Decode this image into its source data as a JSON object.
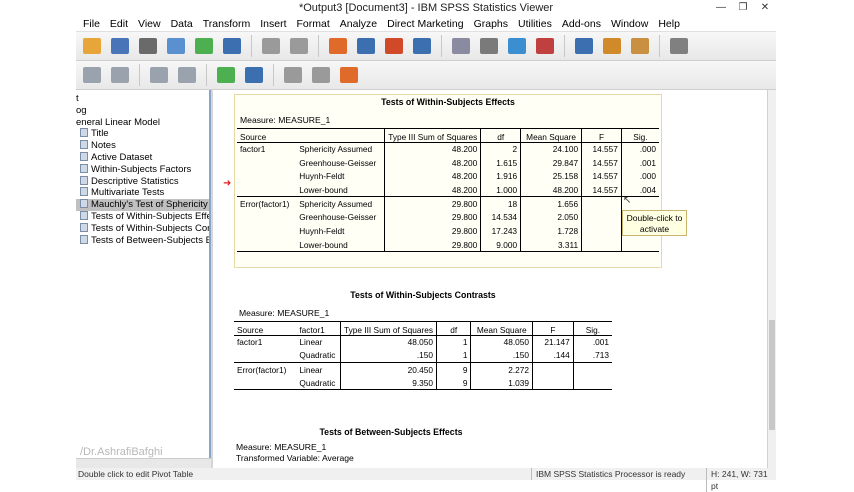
{
  "window": {
    "title": "*Output3 [Document3] - IBM SPSS Statistics Viewer"
  },
  "menu": [
    "File",
    "Edit",
    "View",
    "Data",
    "Transform",
    "Insert",
    "Format",
    "Analyze",
    "Direct Marketing",
    "Graphs",
    "Utilities",
    "Add-ons",
    "Window",
    "Help"
  ],
  "toolbar1_icons": [
    "open-icon",
    "save-icon",
    "print-icon",
    "print-preview-icon",
    "export-icon",
    "recall-dialog-icon",
    "undo-icon",
    "redo-icon",
    "goto-case-icon",
    "goto-variable-icon",
    "insert-cases-icon",
    "variables-icon",
    "select-cases-icon",
    "split-file-icon",
    "weight-cases-icon",
    "value-labels-icon",
    "use-sets-icon",
    "script-icon",
    "designate-window-icon",
    "syntax-icon"
  ],
  "toolbar2_icons": [
    "back-icon",
    "forward-icon",
    "expand-icon",
    "collapse-icon",
    "show-icon",
    "hide-icon",
    "insert-heading-icon",
    "insert-title-icon",
    "insert-text-icon"
  ],
  "tree": {
    "items": [
      {
        "label": "t",
        "indent": 0
      },
      {
        "label": "og",
        "indent": 0
      },
      {
        "label": "eneral Linear Model",
        "indent": 0
      },
      {
        "label": "Title",
        "indent": 1
      },
      {
        "label": "Notes",
        "indent": 1
      },
      {
        "label": "Active Dataset",
        "indent": 1
      },
      {
        "label": "Within-Subjects Factors",
        "indent": 1
      },
      {
        "label": "Descriptive Statistics",
        "indent": 1
      },
      {
        "label": "Multivariate Tests",
        "indent": 1
      },
      {
        "label": "Mauchly's Test of Sphericity",
        "indent": 1,
        "selected": true
      },
      {
        "label": "Tests of Within-Subjects Effects",
        "indent": 1
      },
      {
        "label": "Tests of Within-Subjects Contra",
        "indent": 1
      },
      {
        "label": "Tests of Between-Subjects Effe",
        "indent": 1
      }
    ],
    "watermark": "/Dr.AshrafiBafghi"
  },
  "effects": {
    "title": "Tests of Within-Subjects Effects",
    "measure": "Measure: MEASURE_1",
    "headers": {
      "source": "Source",
      "ss": "Type III Sum of Squares",
      "df": "df",
      "ms": "Mean Square",
      "f": "F",
      "sig": "Sig."
    },
    "rows": [
      [
        "factor1",
        "Sphericity Assumed",
        "48.200",
        "2",
        "24.100",
        "14.557",
        ".000"
      ],
      [
        "",
        "Greenhouse-Geisser",
        "48.200",
        "1.615",
        "29.847",
        "14.557",
        ".001"
      ],
      [
        "",
        "Huynh-Feldt",
        "48.200",
        "1.916",
        "25.158",
        "14.557",
        ".000"
      ],
      [
        "",
        "Lower-bound",
        "48.200",
        "1.000",
        "48.200",
        "14.557",
        ".004"
      ],
      [
        "Error(factor1)",
        "Sphericity Assumed",
        "29.800",
        "18",
        "1.656",
        "",
        ""
      ],
      [
        "",
        "Greenhouse-Geisser",
        "29.800",
        "14.534",
        "2.050",
        "",
        ""
      ],
      [
        "",
        "Huynh-Feldt",
        "29.800",
        "17.243",
        "1.728",
        "",
        ""
      ],
      [
        "",
        "Lower-bound",
        "29.800",
        "9.000",
        "3.311",
        "",
        ""
      ]
    ],
    "tooltip": "Double-click to activate"
  },
  "contrasts": {
    "title": "Tests of Within-Subjects Contrasts",
    "measure": "Measure: MEASURE_1",
    "headers": {
      "source": "Source",
      "factor": "factor1",
      "ss": "Type III Sum of Squares",
      "df": "df",
      "ms": "Mean Square",
      "f": "F",
      "sig": "Sig."
    },
    "rows": [
      [
        "factor1",
        "Linear",
        "48.050",
        "1",
        "48.050",
        "21.147",
        ".001"
      ],
      [
        "",
        "Quadratic",
        ".150",
        "1",
        ".150",
        ".144",
        ".713"
      ],
      [
        "Error(factor1)",
        "Linear",
        "20.450",
        "9",
        "2.272",
        "",
        ""
      ],
      [
        "",
        "Quadratic",
        "9.350",
        "9",
        "1.039",
        "",
        ""
      ]
    ]
  },
  "between": {
    "title": "Tests of Between-Subjects Effects",
    "measure": "Measure: MEASURE_1",
    "transformed": "Transformed Variable: Average"
  },
  "status": {
    "left": "Double click to edit Pivot Table",
    "processor": "IBM SPSS Statistics Processor is ready",
    "dims": "H: 241, W: 731 pt"
  }
}
